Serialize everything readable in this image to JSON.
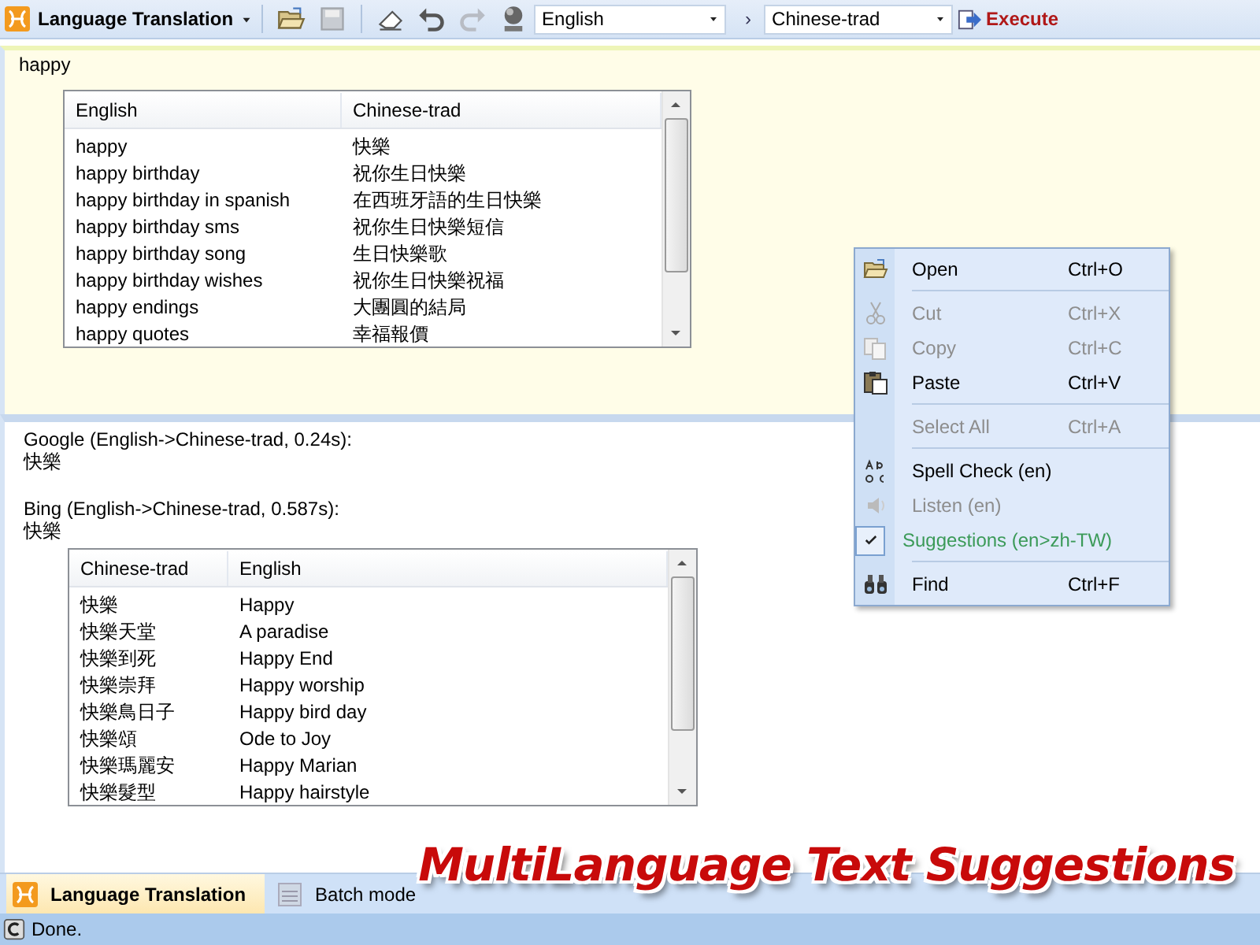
{
  "toolbar": {
    "title": "Language Translation",
    "source_language": "English",
    "separator": "›",
    "target_language": "Chinese-trad",
    "execute": "Execute"
  },
  "input": {
    "text": "happy"
  },
  "suggestions": {
    "columns": [
      "English",
      "Chinese-trad"
    ],
    "rows": [
      [
        "happy",
        "快樂"
      ],
      [
        "happy birthday",
        "祝你生日快樂"
      ],
      [
        "happy birthday in spanish",
        "在西班牙語的生日快樂"
      ],
      [
        "happy birthday sms",
        "祝你生日快樂短信"
      ],
      [
        "happy birthday song",
        "生日快樂歌"
      ],
      [
        "happy birthday wishes",
        "祝你生日快樂祝福"
      ],
      [
        "happy endings",
        "大團圓的結局"
      ],
      [
        "happy quotes",
        "幸福報價"
      ]
    ]
  },
  "results": [
    {
      "heading": "Google (English->Chinese-trad, 0.24s):",
      "text": "快樂"
    },
    {
      "heading": "Bing (English->Chinese-trad, 0.587s):",
      "text": "快樂"
    }
  ],
  "bing_suggestions": {
    "columns": [
      "Chinese-trad",
      "English"
    ],
    "rows": [
      [
        "快樂",
        "Happy"
      ],
      [
        "快樂天堂",
        "A paradise"
      ],
      [
        "快樂到死",
        "Happy End"
      ],
      [
        "快樂崇拜",
        "Happy worship"
      ],
      [
        "快樂鳥日子",
        "Happy bird day"
      ],
      [
        "快樂頌",
        "Ode to Joy"
      ],
      [
        "快樂瑪麗安",
        "Happy Marian"
      ],
      [
        "快樂髮型",
        "Happy hairstyle"
      ]
    ]
  },
  "context_menu": [
    {
      "kind": "item",
      "label": "Open",
      "shortcut": "Ctrl+O",
      "disabled": false,
      "checked": false
    },
    {
      "kind": "separator"
    },
    {
      "kind": "item",
      "label": "Cut",
      "shortcut": "Ctrl+X",
      "disabled": true,
      "checked": false
    },
    {
      "kind": "item",
      "label": "Copy",
      "shortcut": "Ctrl+C",
      "disabled": true,
      "checked": false
    },
    {
      "kind": "item",
      "label": "Paste",
      "shortcut": "Ctrl+V",
      "disabled": false,
      "checked": false
    },
    {
      "kind": "separator"
    },
    {
      "kind": "item",
      "label": "Select All",
      "shortcut": "Ctrl+A",
      "disabled": true,
      "checked": false
    },
    {
      "kind": "separator"
    },
    {
      "kind": "item",
      "label": "Spell Check (en)",
      "disabled": false,
      "checked": false
    },
    {
      "kind": "item",
      "label": "Listen (en)",
      "disabled": true,
      "checked": false
    },
    {
      "kind": "item",
      "label": "Suggestions (en>zh-TW)",
      "disabled": false,
      "checked": true
    },
    {
      "kind": "separator"
    },
    {
      "kind": "item",
      "label": "Find",
      "shortcut": "Ctrl+F",
      "disabled": false,
      "checked": false
    }
  ],
  "bottom_tabs": [
    {
      "label": "Language Translation",
      "selected": true
    },
    {
      "label": "Batch mode",
      "selected": false
    }
  ],
  "status_bar": {
    "text": "Done."
  },
  "caption": "MultiLanguage Text Suggestions"
}
